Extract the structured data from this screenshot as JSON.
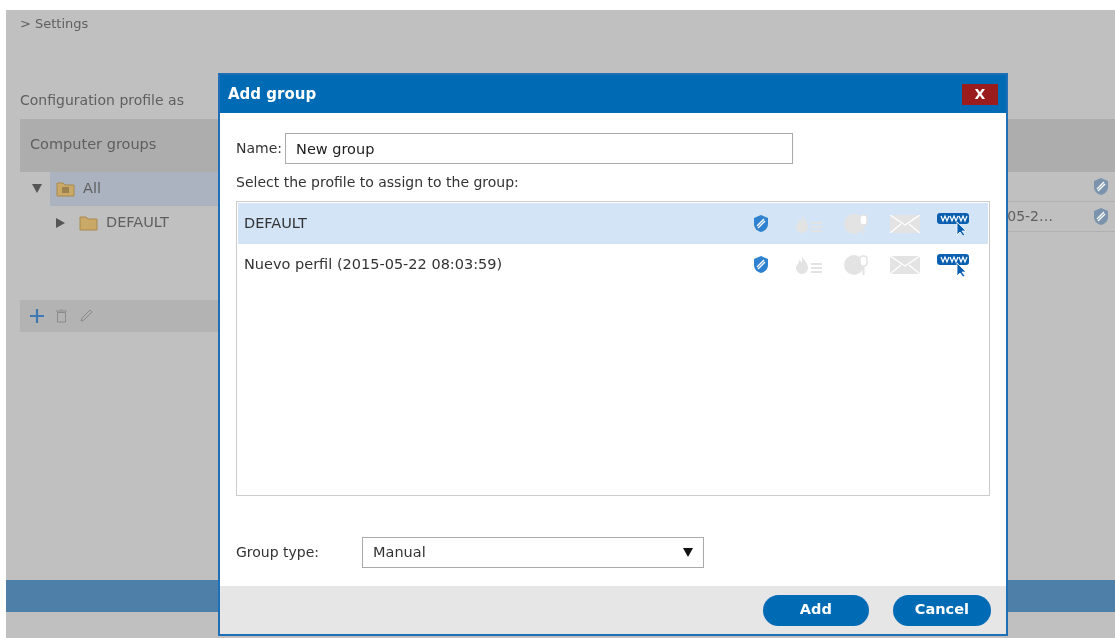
{
  "breadcrumb": "> Settings",
  "section_title": "Configuration profile as",
  "groups_panel": {
    "title": "Computer groups",
    "tree": [
      {
        "label": "All",
        "kind": "root",
        "expanded": true,
        "selected": true,
        "children": [
          {
            "label": "DEFAULT",
            "kind": "folder",
            "expanded": false,
            "selected": false
          }
        ]
      }
    ]
  },
  "assignment_rows": [
    {
      "kind": "partial"
    },
    {
      "kind": "dated",
      "date": "05-2…"
    }
  ],
  "dialog": {
    "title": "Add group",
    "close_label": "X",
    "name_label": "Name:",
    "name_value": "New group",
    "prompt": "Select the profile to assign to the group:",
    "profiles": [
      {
        "name": "DEFAULT",
        "selected": true,
        "modules": [
          {
            "enabled": true
          },
          {
            "enabled": false
          },
          {
            "enabled": false
          },
          {
            "enabled": false
          },
          {
            "enabled": true
          }
        ]
      },
      {
        "name": "Nuevo perfil (2015-05-22 08:03:59)",
        "selected": false,
        "modules": [
          {
            "enabled": true
          },
          {
            "enabled": false
          },
          {
            "enabled": false
          },
          {
            "enabled": false
          },
          {
            "enabled": true
          }
        ]
      }
    ],
    "group_type_label": "Group type:",
    "group_type_value": "Manual",
    "buttons": [
      {
        "label": "Add"
      },
      {
        "label": "Cancel"
      }
    ]
  }
}
